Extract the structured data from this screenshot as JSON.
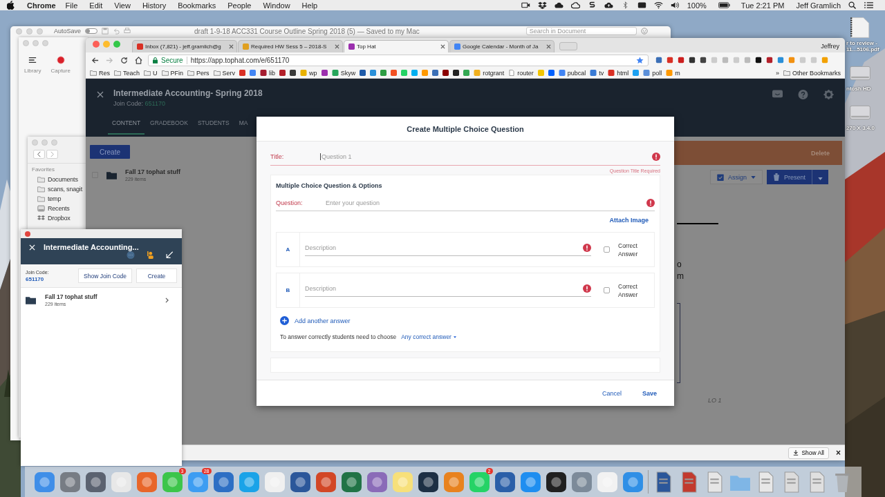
{
  "menu_bar": {
    "app": "Chrome",
    "menus": [
      "File",
      "Edit",
      "View",
      "History",
      "Bookmarks",
      "People",
      "Window",
      "Help"
    ],
    "battery": "100%",
    "clock": "Tue 2:21 PM",
    "user": "Jeff Gramlich"
  },
  "desktop_items": [
    {
      "kind": "document",
      "lines": [
        "r to review -",
        "11...5106.pdf"
      ]
    },
    {
      "kind": "disk",
      "lines": [
        "ntosh HD"
      ]
    },
    {
      "kind": "disk",
      "lines": [
        "270 X 3.4.0"
      ]
    }
  ],
  "word_window": {
    "autosave": "AutoSave",
    "autosave_on": false,
    "title": "draft 1-9-18 ACC331 Course Outline Spring 2018 (5) — Saved to my Mac",
    "search_placeholder": "Search in Document"
  },
  "snagit": {
    "tools": [
      "Library",
      "Capture"
    ]
  },
  "finder": {
    "section": "Favorites",
    "items": [
      {
        "kind": "folder",
        "label": "Documents"
      },
      {
        "kind": "folder",
        "label": "scans, snagit"
      },
      {
        "kind": "folder",
        "label": "temp"
      },
      {
        "kind": "recents",
        "label": "Recents"
      },
      {
        "kind": "dropbox",
        "label": "Dropbox"
      }
    ]
  },
  "browser": {
    "tabs": [
      {
        "title": "Inbox (7,821) - jeff.gramlich@g",
        "selected": false,
        "color": "#d93025"
      },
      {
        "title": "Required HW Sess 5 – 2018-S",
        "selected": false,
        "color": "#e0a020"
      },
      {
        "title": "Top Hat",
        "selected": true,
        "color": "#9b2fae"
      },
      {
        "title": "Google Calendar - Month of Ja",
        "selected": false,
        "color": "#4285f4"
      }
    ],
    "profile": "Jeffrey",
    "secure": "Secure",
    "url": "https://app.tophat.com/e/651170",
    "bookmarks": [
      {
        "kind": "folder",
        "label": "Res"
      },
      {
        "kind": "folder",
        "label": "Teach"
      },
      {
        "kind": "folder",
        "label": "U"
      },
      {
        "kind": "folder",
        "label": "PFin"
      },
      {
        "kind": "folder",
        "label": "Pers"
      },
      {
        "kind": "folder",
        "label": "Serv"
      },
      {
        "kind": "site",
        "color": "#d93025"
      },
      {
        "kind": "site",
        "color": "#4285f4"
      },
      {
        "kind": "site",
        "label": "lib",
        "color": "#a51c30"
      },
      {
        "kind": "site",
        "color": "#b3202a"
      },
      {
        "kind": "site",
        "color": "#3a3a3a"
      },
      {
        "kind": "site",
        "label": "wp",
        "color": "#e8b100"
      },
      {
        "kind": "site",
        "color": "#9b2fae"
      },
      {
        "kind": "site",
        "label": "Skyw",
        "color": "#26a65b"
      },
      {
        "kind": "site",
        "color": "#1e5aa8"
      },
      {
        "kind": "site",
        "color": "#2a8fd8"
      },
      {
        "kind": "site",
        "color": "#2e9d44"
      },
      {
        "kind": "site",
        "color": "#f25022"
      },
      {
        "kind": "site",
        "color": "#25d366"
      },
      {
        "kind": "site",
        "color": "#00aff0"
      },
      {
        "kind": "site",
        "color": "#ff9900"
      },
      {
        "kind": "site",
        "color": "#3b6fb6"
      },
      {
        "kind": "site",
        "color": "#8b0000"
      },
      {
        "kind": "site",
        "color": "#222222"
      },
      {
        "kind": "site",
        "color": "#34a853"
      },
      {
        "kind": "site",
        "label": "rotgrant",
        "color": "#f2b01e"
      },
      {
        "kind": "page",
        "label": "router"
      },
      {
        "kind": "site",
        "color": "#f2c500"
      },
      {
        "kind": "site",
        "color": "#0061fe"
      },
      {
        "kind": "site",
        "label": "pubcal",
        "color": "#4285f4"
      },
      {
        "kind": "site",
        "label": "tv",
        "color": "#3a7bd5"
      },
      {
        "kind": "site",
        "label": "html",
        "color": "#d93025"
      },
      {
        "kind": "site",
        "color": "#1da1f2"
      },
      {
        "kind": "site",
        "label": "poll",
        "color": "#5b8fd9"
      },
      {
        "kind": "site",
        "label": "m",
        "color": "#ff9900"
      }
    ],
    "more": "»",
    "other_bookmarks": "Other Bookmarks",
    "show_all": "Show All",
    "close_downloads": "×"
  },
  "course": {
    "title": "Intermediate Accounting- Spring 2018",
    "join_label": "Join Code:",
    "join_code": "651170",
    "nav": [
      {
        "label": "CONTENT",
        "selected": true
      },
      {
        "label": "GRADEBOOK",
        "selected": false
      },
      {
        "label": "STUDENTS",
        "selected": false
      },
      {
        "label": "MA",
        "selected": false
      }
    ],
    "create": "Create",
    "folder": {
      "name": "Fall 17 tophat stuff",
      "count": "229 items",
      "checked": false
    },
    "delete": "Delete",
    "assign": "Assign",
    "present": "Present",
    "slide_fragments": [
      "o",
      "m"
    ],
    "slide_label": "LO 1"
  },
  "modal": {
    "title": "Create Multiple Choice Question",
    "title_label": "Title:",
    "title_placeholder": "Question 1",
    "title_error": "Question Title Required",
    "section": "Multiple Choice Question & Options",
    "question_label": "Question:",
    "question_placeholder": "Enter your question",
    "attach": "Attach Image",
    "answers": [
      {
        "letter": "A",
        "placeholder": "Description",
        "correct": false,
        "correct_label": "Correct Answer"
      },
      {
        "letter": "B",
        "placeholder": "Description",
        "correct": false,
        "correct_label": "Correct Answer"
      }
    ],
    "add_answer": "Add another answer",
    "choose_text": "To answer correctly students need to choose",
    "choose_value": "Any correct answer",
    "cancel": "Cancel",
    "save": "Save"
  },
  "mini_window": {
    "title": "Intermediate Accounting...",
    "join_label": "Join Code:",
    "join_code": "651170",
    "buttons": [
      "Show Join Code",
      "Create"
    ],
    "folder": {
      "name": "Fall 17 tophat stuff",
      "count": "229 items"
    }
  },
  "dock": {
    "items": [
      {
        "kind": "app"
      },
      {
        "kind": "app"
      },
      {
        "kind": "app"
      },
      {
        "kind": "app"
      },
      {
        "kind": "app"
      },
      {
        "kind": "app",
        "badge": "3"
      },
      {
        "kind": "app",
        "badge": "28"
      },
      {
        "kind": "app"
      },
      {
        "kind": "app"
      },
      {
        "kind": "app"
      },
      {
        "kind": "app"
      },
      {
        "kind": "app"
      },
      {
        "kind": "app"
      },
      {
        "kind": "app"
      },
      {
        "kind": "app"
      },
      {
        "kind": "app"
      },
      {
        "kind": "app"
      },
      {
        "kind": "app",
        "badge": "2"
      },
      {
        "kind": "app"
      },
      {
        "kind": "app"
      },
      {
        "kind": "app"
      },
      {
        "kind": "app"
      },
      {
        "kind": "app"
      },
      {
        "kind": "app"
      },
      {
        "kind": "separator"
      },
      {
        "kind": "document"
      },
      {
        "kind": "document"
      },
      {
        "kind": "document"
      },
      {
        "kind": "folder"
      },
      {
        "kind": "document"
      },
      {
        "kind": "document"
      },
      {
        "kind": "document"
      },
      {
        "kind": "trash"
      }
    ]
  }
}
